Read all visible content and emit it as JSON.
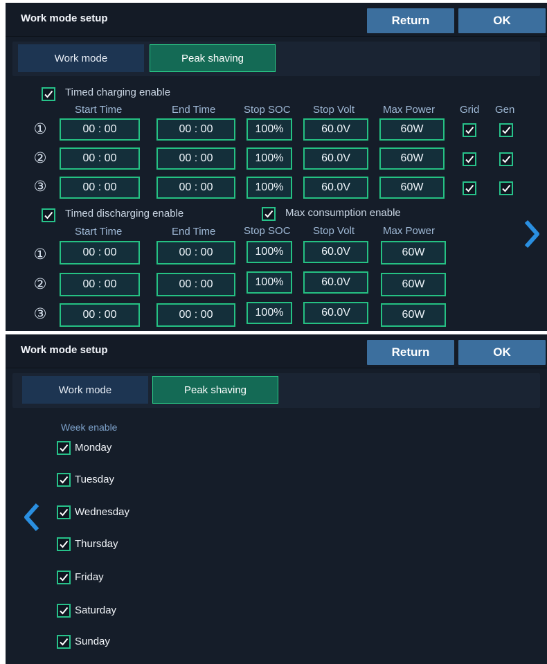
{
  "screens": [
    {
      "title": "Work mode setup",
      "return_label": "Return",
      "ok_label": "OK",
      "tabs": [
        "Work mode",
        "Peak shaving"
      ],
      "active_tab": "Peak shaving",
      "charging": {
        "enable_label": "Timed charging enable",
        "enabled": true,
        "columns": [
          "Start Time",
          "End Time",
          "Stop SOC",
          "Stop Volt",
          "Max Power",
          "Grid",
          "Gen"
        ],
        "rows": [
          {
            "index": "①",
            "start": "00 : 00",
            "end": "00 : 00",
            "soc": "100%",
            "volt": "60.0V",
            "power": "60W",
            "grid": true,
            "gen": true
          },
          {
            "index": "②",
            "start": "00 : 00",
            "end": "00 : 00",
            "soc": "100%",
            "volt": "60.0V",
            "power": "60W",
            "grid": true,
            "gen": true
          },
          {
            "index": "③",
            "start": "00 : 00",
            "end": "00 : 00",
            "soc": "100%",
            "volt": "60.0V",
            "power": "60W",
            "grid": true,
            "gen": true
          }
        ]
      },
      "discharging": {
        "enable_label": "Timed discharging enable",
        "enabled": true,
        "max_consumption_label": "Max consumption enable",
        "max_consumption_enabled": true,
        "columns": [
          "Start Time",
          "End Time",
          "Stop SOC",
          "Stop Volt",
          "Max Power"
        ],
        "rows": [
          {
            "index": "①",
            "start": "00 : 00",
            "end": "00 : 00",
            "soc": "100%",
            "volt": "60.0V",
            "power": "60W"
          },
          {
            "index": "②",
            "start": "00 : 00",
            "end": "00 : 00",
            "soc": "100%",
            "volt": "60.0V",
            "power": "60W"
          },
          {
            "index": "③",
            "start": "00 : 00",
            "end": "00 : 00",
            "soc": "100%",
            "volt": "60.0V",
            "power": "60W"
          }
        ]
      },
      "nav_icon": "chevron-right-icon"
    },
    {
      "title": "Work mode setup",
      "return_label": "Return",
      "ok_label": "OK",
      "tabs": [
        "Work mode",
        "Peak shaving"
      ],
      "active_tab": "Peak shaving",
      "week_label": "Week enable",
      "days": [
        {
          "label": "Monday",
          "checked": true
        },
        {
          "label": "Tuesday",
          "checked": true
        },
        {
          "label": "Wednesday",
          "checked": true
        },
        {
          "label": "Thursday",
          "checked": true
        },
        {
          "label": "Friday",
          "checked": true
        },
        {
          "label": "Saturday",
          "checked": true
        },
        {
          "label": "Sunday",
          "checked": true
        }
      ],
      "nav_icon": "chevron-left-icon"
    }
  ],
  "colors": {
    "accent_green": "#27c28a",
    "active_tab": "#146a55",
    "button_blue": "#3c6f9e",
    "chevron_blue": "#2a8fe0"
  }
}
